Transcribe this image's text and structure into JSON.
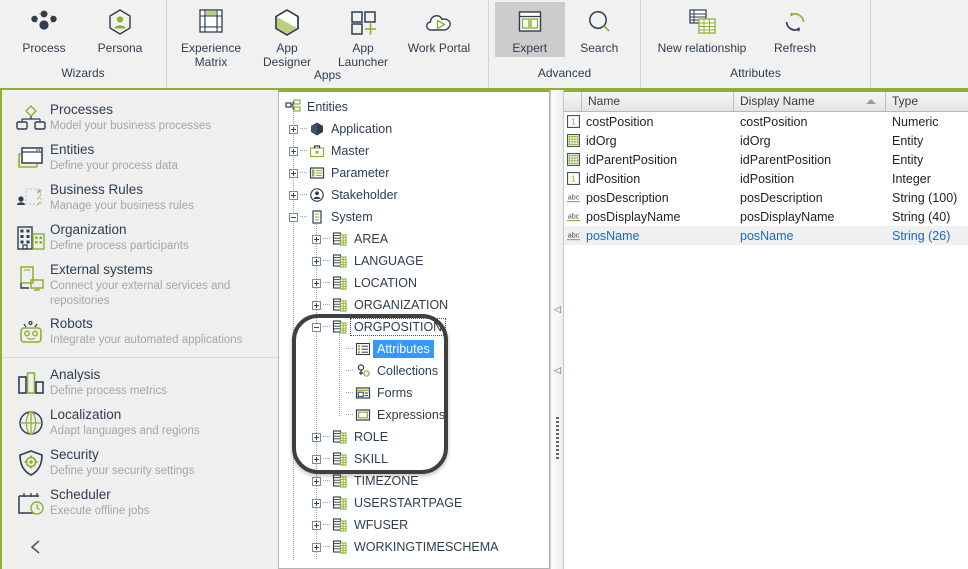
{
  "ribbon": {
    "groups": [
      {
        "label": "Wizards",
        "buttons": [
          {
            "label": "Process",
            "icon": "process-network-icon",
            "active": false
          },
          {
            "label": "Persona",
            "icon": "persona-hexagon-icon",
            "active": false
          }
        ]
      },
      {
        "label": "Apps",
        "buttons": [
          {
            "label": "Experience\nMatrix",
            "icon": "experience-matrix-icon",
            "active": false
          },
          {
            "label": "App Designer",
            "icon": "app-designer-hexagon-icon",
            "active": false
          },
          {
            "label": "App Launcher",
            "icon": "app-launcher-grid-icon",
            "active": false
          },
          {
            "label": "Work Portal",
            "icon": "work-portal-cloud-icon",
            "active": false
          }
        ]
      },
      {
        "label": "Advanced",
        "buttons": [
          {
            "label": "Expert",
            "icon": "expert-panels-icon",
            "active": true
          },
          {
            "label": "Search",
            "icon": "search-magnifier-icon",
            "active": false
          }
        ]
      },
      {
        "label": "Attributes",
        "buttons": [
          {
            "label": "New relationship",
            "icon": "new-relationship-table-icon",
            "active": false
          },
          {
            "label": "Refresh",
            "icon": "refresh-circular-arrows-icon",
            "active": false
          }
        ]
      }
    ]
  },
  "sidebar": {
    "collapse_glyph": "‹",
    "items": [
      {
        "title": "Processes",
        "subtitle": "Model your business processes",
        "icon": "processes-flow-icon",
        "separator_before": false
      },
      {
        "title": "Entities",
        "subtitle": "Define your process data",
        "icon": "entities-window-icon",
        "separator_before": false
      },
      {
        "title": "Business Rules",
        "subtitle": "Manage your business rules",
        "icon": "business-rules-icon",
        "separator_before": false
      },
      {
        "title": "Organization",
        "subtitle": "Define process participants",
        "icon": "organization-building-icon",
        "separator_before": false
      },
      {
        "title": "External systems",
        "subtitle": "Connect your external services and repositories",
        "icon": "external-systems-icon",
        "separator_before": false
      },
      {
        "title": "Robots",
        "subtitle": "Integrate your automated applications",
        "icon": "robot-icon",
        "separator_before": false
      },
      {
        "title": "Analysis",
        "subtitle": "Define process metrics",
        "icon": "analysis-bars-icon",
        "separator_before": true
      },
      {
        "title": "Localization",
        "subtitle": "Adapt languages and regions",
        "icon": "localization-globe-icon",
        "separator_before": false
      },
      {
        "title": "Security",
        "subtitle": "Define your security settings",
        "icon": "security-shield-icon",
        "separator_before": false
      },
      {
        "title": "Scheduler",
        "subtitle": "Execute offline jobs",
        "icon": "scheduler-calendar-icon",
        "separator_before": false
      }
    ]
  },
  "tree": {
    "root": {
      "label": "Entities",
      "icon": "entities-root-icon"
    },
    "nodes": [
      {
        "label": "Application",
        "icon": "application-hexagon-icon",
        "depth": 1,
        "toggle": "plus",
        "selected": false
      },
      {
        "label": "Master",
        "icon": "master-briefcase-icon",
        "depth": 1,
        "toggle": "plus",
        "selected": false
      },
      {
        "label": "Parameter",
        "icon": "parameter-panel-icon",
        "depth": 1,
        "toggle": "plus",
        "selected": false
      },
      {
        "label": "Stakeholder",
        "icon": "stakeholder-person-icon",
        "depth": 1,
        "toggle": "plus",
        "selected": false
      },
      {
        "label": "System",
        "icon": "system-doc-icon",
        "depth": 1,
        "toggle": "minus",
        "selected": false
      },
      {
        "label": "AREA",
        "icon": "entity-table-icon",
        "depth": 2,
        "toggle": "plus",
        "selected": false
      },
      {
        "label": "LANGUAGE",
        "icon": "entity-table-icon",
        "depth": 2,
        "toggle": "plus",
        "selected": false
      },
      {
        "label": "LOCATION",
        "icon": "entity-table-icon",
        "depth": 2,
        "toggle": "plus",
        "selected": false
      },
      {
        "label": "ORGANIZATION",
        "icon": "entity-table-icon",
        "depth": 2,
        "toggle": "plus",
        "selected": false
      },
      {
        "label": "ORGPOSITION",
        "icon": "entity-table-icon",
        "depth": 2,
        "toggle": "minus",
        "selected": false,
        "focused": true
      },
      {
        "label": "Attributes",
        "icon": "attributes-list-icon",
        "depth": 3,
        "toggle": "none",
        "selected": true
      },
      {
        "label": "Collections",
        "icon": "collections-icon",
        "depth": 3,
        "toggle": "none",
        "selected": false
      },
      {
        "label": "Forms",
        "icon": "forms-icon",
        "depth": 3,
        "toggle": "none",
        "selected": false
      },
      {
        "label": "Expressions",
        "icon": "expressions-icon",
        "depth": 3,
        "toggle": "none",
        "selected": false
      },
      {
        "label": "ROLE",
        "icon": "entity-table-icon",
        "depth": 2,
        "toggle": "plus",
        "selected": false
      },
      {
        "label": "SKILL",
        "icon": "entity-table-icon",
        "depth": 2,
        "toggle": "plus",
        "selected": false
      },
      {
        "label": "TIMEZONE",
        "icon": "entity-table-icon",
        "depth": 2,
        "toggle": "plus",
        "selected": false
      },
      {
        "label": "USERSTARTPAGE",
        "icon": "entity-table-icon",
        "depth": 2,
        "toggle": "plus",
        "selected": false
      },
      {
        "label": "WFUSER",
        "icon": "entity-table-icon",
        "depth": 2,
        "toggle": "plus",
        "selected": false
      },
      {
        "label": "WORKINGTIMESCHEMA",
        "icon": "entity-table-icon",
        "depth": 2,
        "toggle": "plus",
        "selected": false
      }
    ]
  },
  "splitter": {
    "arrow_glyph": "◁"
  },
  "grid": {
    "columns": [
      {
        "key": "name",
        "label": "Name",
        "sorted": false
      },
      {
        "key": "display_name",
        "label": "Display Name",
        "sorted": true,
        "sort_dir": "asc"
      },
      {
        "key": "type",
        "label": "Type",
        "sorted": false
      }
    ],
    "rows": [
      {
        "icon": "numeric-type-icon",
        "name": "costPosition",
        "display_name": "costPosition",
        "type": "Numeric",
        "selected": false
      },
      {
        "icon": "entity-type-icon",
        "name": "idOrg",
        "display_name": "idOrg",
        "type": "Entity",
        "selected": false
      },
      {
        "icon": "entity-type-icon",
        "name": "idParentPosition",
        "display_name": "idParentPosition",
        "type": "Entity",
        "selected": false
      },
      {
        "icon": "numeric-type-icon",
        "name": "idPosition",
        "display_name": "idPosition",
        "type": "Integer",
        "selected": false
      },
      {
        "icon": "string-type-icon",
        "name": "posDescription",
        "display_name": "posDescription",
        "type": "String (100)",
        "selected": false
      },
      {
        "icon": "string-type-icon",
        "name": "posDisplayName",
        "display_name": "posDisplayName",
        "type": "String (40)",
        "selected": false
      },
      {
        "icon": "string-type-icon",
        "name": "posName",
        "display_name": "posName",
        "type": "String (26)",
        "selected": true
      }
    ]
  },
  "colors": {
    "accent_green": "#8db033",
    "icon_green": "#a4c23f",
    "dark_navy": "#2c3e50",
    "selection_blue": "#3399ff",
    "row_selected_text": "#1569c7",
    "row_selected_bg": "#f0f0f0",
    "ribbon_bg": "#f1f1f1",
    "sidebar_bg": "#efefef",
    "active_button_bg": "#cccccc"
  }
}
